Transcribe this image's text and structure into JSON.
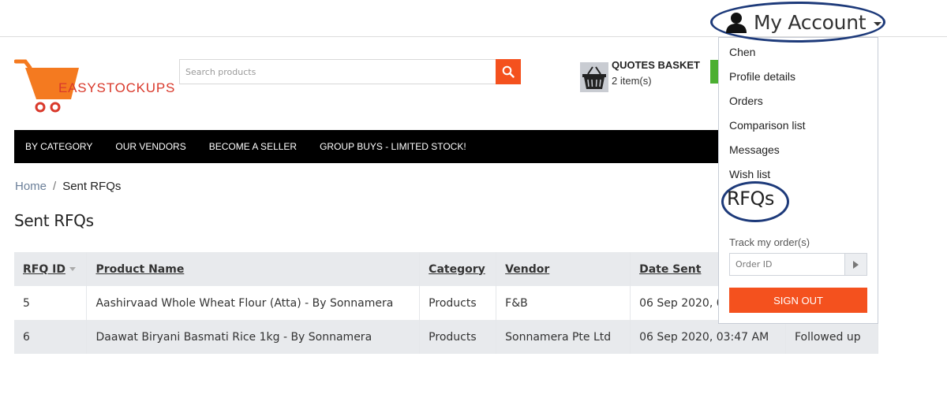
{
  "account": {
    "label": "My Account"
  },
  "logo": {
    "text": "EASYSTOCKUPS"
  },
  "search": {
    "placeholder": "Search products"
  },
  "basket": {
    "title": "QUOTES BASKET",
    "count": "2 item(s)"
  },
  "nav": [
    "BY CATEGORY",
    "OUR VENDORS",
    "BECOME A SELLER",
    "GROUP BUYS - LIMITED STOCK!"
  ],
  "breadcrumb": {
    "home": "Home",
    "separator": "/",
    "current": "Sent RFQs"
  },
  "page_title": "Sent RFQs",
  "table": {
    "headers": [
      "RFQ ID",
      "Product Name",
      "Category",
      "Vendor",
      "Date Sent",
      ""
    ],
    "rows": [
      [
        "5",
        "Aashirvaad Whole Wheat Flour (Atta) - By Sonnamera",
        "Products",
        "F&B",
        "06 Sep 2020, 03:47 AM",
        ""
      ],
      [
        "6",
        "Daawat Biryani Basmati Rice 1kg - By Sonnamera",
        "Products",
        "Sonnamera Pte Ltd",
        "06 Sep 2020, 03:47 AM",
        "Followed up"
      ]
    ]
  },
  "dropdown": {
    "items": [
      "Chen",
      "Profile details",
      "Orders",
      "Comparison list",
      "Messages",
      "Wish list",
      "RFQs"
    ],
    "track_label": "Track my order(s)",
    "order_placeholder": "Order ID",
    "signout": "SIGN OUT"
  },
  "colors": {
    "accent": "#f4511e",
    "nav_bg": "#000000",
    "annotation": "#1d3a7a",
    "table_header": "#e8eaed"
  }
}
